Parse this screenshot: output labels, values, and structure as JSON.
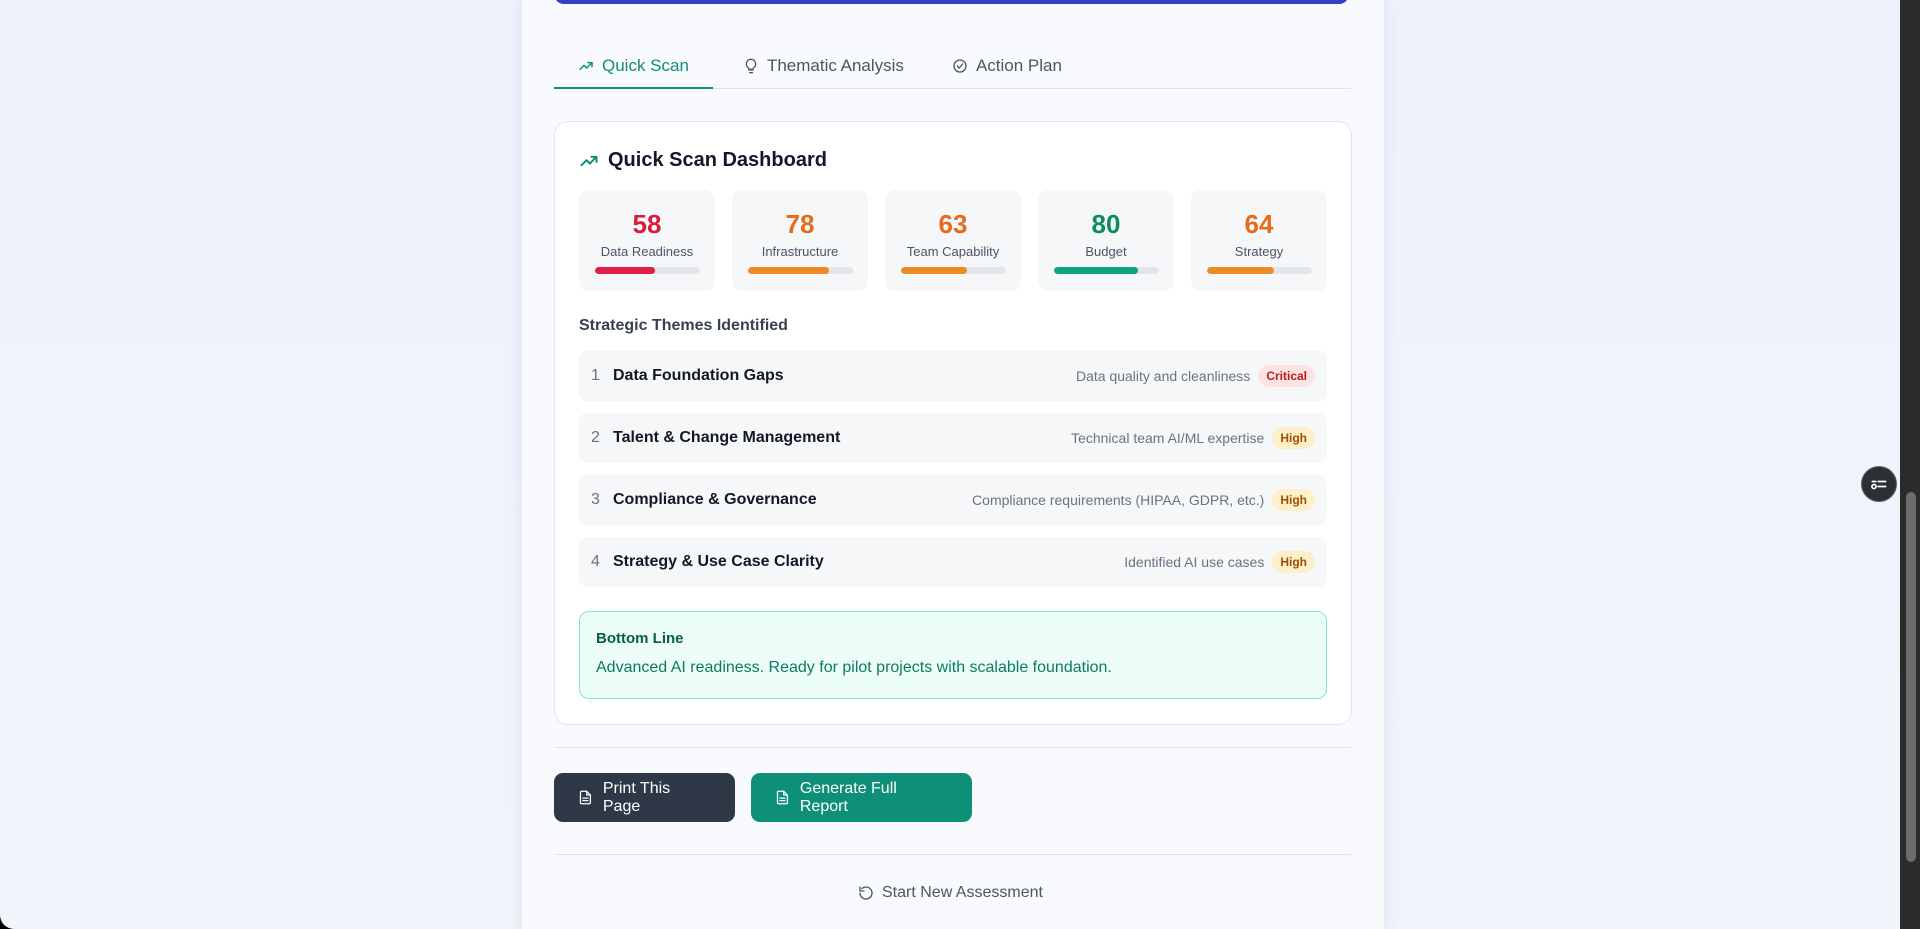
{
  "tabs": [
    {
      "label": "Quick Scan",
      "icon": "trending-up-icon"
    },
    {
      "label": "Thematic Analysis",
      "icon": "lightbulb-icon"
    },
    {
      "label": "Action Plan",
      "icon": "check-circle-icon"
    }
  ],
  "dashboard": {
    "title": "Quick Scan Dashboard",
    "metrics": [
      {
        "value": "58",
        "label": "Data Readiness",
        "percent": 58,
        "color": "#e11d48"
      },
      {
        "value": "78",
        "label": "Infrastructure",
        "percent": 78,
        "color": "#f08a24"
      },
      {
        "value": "63",
        "label": "Team Capability",
        "percent": 63,
        "color": "#f08a24"
      },
      {
        "value": "80",
        "label": "Budget",
        "percent": 80,
        "color": "#10a37f"
      },
      {
        "value": "64",
        "label": "Strategy",
        "percent": 64,
        "color": "#f08a24"
      }
    ],
    "value_colors": [
      "#d81e3c",
      "#e36d1a",
      "#e36d1a",
      "#0e8a62",
      "#e36d1a"
    ]
  },
  "themes": {
    "heading": "Strategic Themes Identified",
    "items": [
      {
        "num": "1",
        "title": "Data Foundation Gaps",
        "desc": "Data quality and cleanliness",
        "badge": "Critical"
      },
      {
        "num": "2",
        "title": "Talent & Change Management",
        "desc": "Technical team AI/ML expertise",
        "badge": "High"
      },
      {
        "num": "3",
        "title": "Compliance & Governance",
        "desc": "Compliance requirements (HIPAA, GDPR, etc.)",
        "badge": "High"
      },
      {
        "num": "4",
        "title": "Strategy & Use Case Clarity",
        "desc": "Identified AI use cases",
        "badge": "High"
      }
    ]
  },
  "bottom_line": {
    "title": "Bottom Line",
    "text": "Advanced AI readiness. Ready for pilot projects with scalable foundation."
  },
  "actions": {
    "print_label": "Print This Page",
    "report_label": "Generate Full Report",
    "restart_label": "Start New Assessment"
  }
}
